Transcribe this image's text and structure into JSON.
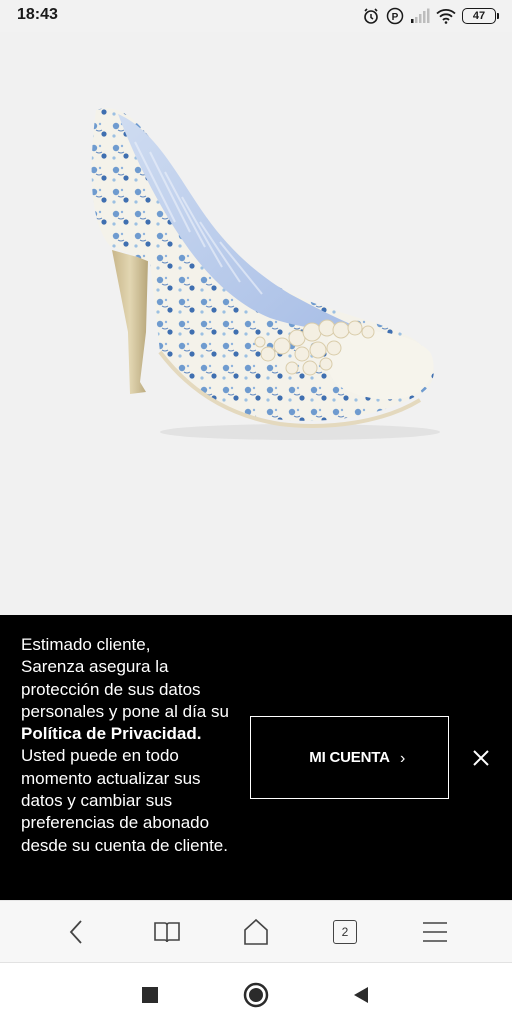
{
  "status_bar": {
    "time": "18:43",
    "icons": [
      "alarm-icon",
      "p-badge-icon",
      "signal-icon",
      "wifi-icon",
      "battery-icon"
    ],
    "battery_level": "47"
  },
  "product": {
    "image": "shoe-image-icon"
  },
  "privacy_banner": {
    "line1": "Estimado cliente,",
    "text_before_link": "Sarenza asegura la protección de sus datos personales y pone al día su",
    "link_text": "Política de Privacidad.",
    "text_after_link": "Usted puede en todo momento actualizar sus datos y cambiar sus preferencias de abonado desde su cuenta de cliente.",
    "button_label": "MI CUENTA",
    "button_chevron": "›",
    "close_icon": "close-icon"
  },
  "browser_toolbar": {
    "items": [
      "back-icon",
      "bookmarks-icon",
      "home-icon",
      "tabs-icon",
      "menu-icon"
    ],
    "tab_count": "2"
  },
  "nav_bar": {
    "items": [
      "recents-icon",
      "home-icon",
      "back-icon"
    ]
  },
  "colors": {
    "banner_bg": "#000000",
    "banner_text": "#ffffff",
    "product_bg": "#f1f1f1"
  }
}
